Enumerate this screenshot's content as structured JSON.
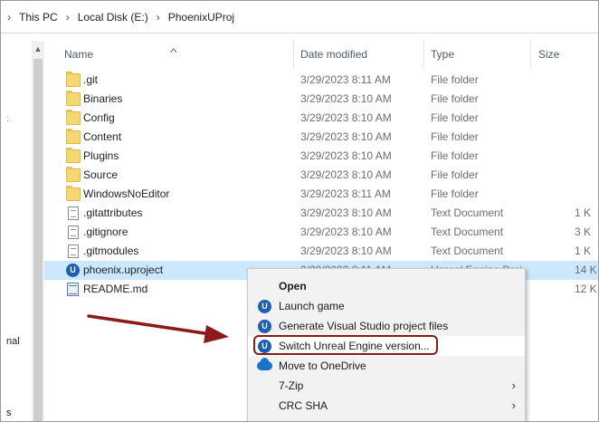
{
  "breadcrumb": {
    "items": [
      "This PC",
      "Local Disk (E:)",
      "PhoenixUProj"
    ]
  },
  "nav": {
    "partial_text_1": "nal",
    "partial_text_2": "s",
    "tick": ":"
  },
  "columns": {
    "name": "Name",
    "date_modified": "Date modified",
    "type": "Type",
    "size": "Size"
  },
  "files": [
    {
      "name": ".git",
      "date": "3/29/2023 8:11 AM",
      "type": "File folder",
      "size": "",
      "icon": "folder-icon"
    },
    {
      "name": "Binaries",
      "date": "3/29/2023 8:10 AM",
      "type": "File folder",
      "size": "",
      "icon": "folder-icon"
    },
    {
      "name": "Config",
      "date": "3/29/2023 8:10 AM",
      "type": "File folder",
      "size": "",
      "icon": "folder-icon"
    },
    {
      "name": "Content",
      "date": "3/29/2023 8:10 AM",
      "type": "File folder",
      "size": "",
      "icon": "folder-icon"
    },
    {
      "name": "Plugins",
      "date": "3/29/2023 8:10 AM",
      "type": "File folder",
      "size": "",
      "icon": "folder-icon"
    },
    {
      "name": "Source",
      "date": "3/29/2023 8:10 AM",
      "type": "File folder",
      "size": "",
      "icon": "folder-icon"
    },
    {
      "name": "WindowsNoEditor",
      "date": "3/29/2023 8:11 AM",
      "type": "File folder",
      "size": "",
      "icon": "folder-icon"
    },
    {
      "name": ".gitattributes",
      "date": "3/29/2023 8:10 AM",
      "type": "Text Document",
      "size": "1 K",
      "icon": "text-document-icon"
    },
    {
      "name": ".gitignore",
      "date": "3/29/2023 8:10 AM",
      "type": "Text Document",
      "size": "3 K",
      "icon": "text-document-icon"
    },
    {
      "name": ".gitmodules",
      "date": "3/29/2023 8:10 AM",
      "type": "Text Document",
      "size": "1 K",
      "icon": "text-document-icon"
    },
    {
      "name": "phoenix.uproject",
      "date": "3/29/2023 8:11 AM",
      "type": "Unreal Engine Proj",
      "size": "14 K",
      "icon": "unreal-engine-icon"
    },
    {
      "name": "README.md",
      "date": "",
      "type": "",
      "size": "12 K",
      "icon": "markdown-file-icon"
    }
  ],
  "context_menu": {
    "open": "Open",
    "launch_game": "Launch game",
    "generate_vs": "Generate Visual Studio project files",
    "switch_ue": "Switch Unreal Engine version...",
    "onedrive": "Move to OneDrive",
    "sevenzip": "7-Zip",
    "crcsha": "CRC SHA",
    "chevron": "›"
  },
  "icons": {
    "ue_glyph": "U",
    "sort_up": "^",
    "sep": "›",
    "scroll_up": "▲"
  },
  "colors": {
    "selected_row": "#cce8ff",
    "annotation_red": "#8b1a1a",
    "unreal_blue": "#1a5fb4"
  }
}
